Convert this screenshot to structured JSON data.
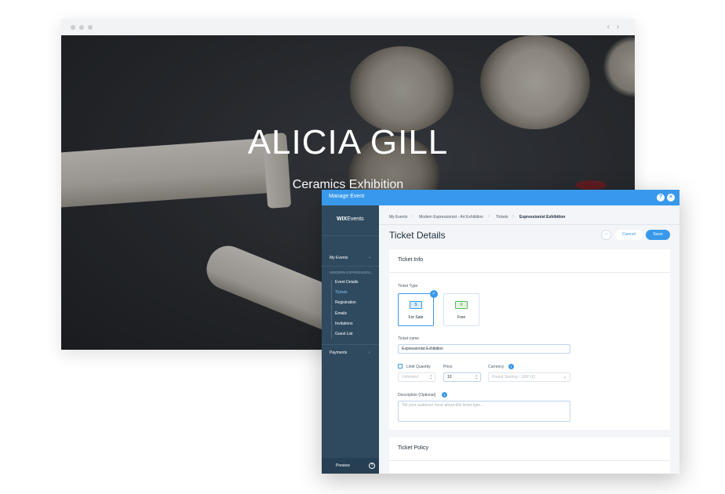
{
  "hero": {
    "title": "ALICIA GILL",
    "subtitle": "Ceramics Exhibition"
  },
  "dialog": {
    "title": "Manage Event",
    "help_icon": "?",
    "close_icon": "×"
  },
  "sidebar": {
    "logo_bold": "WIX",
    "logo_rest": "Events",
    "my_events": "My Events",
    "section": "MODERN EXPRESSIONI...",
    "items": [
      "Event Details",
      "Tickets",
      "Registration",
      "Emails",
      "Invitations",
      "Guest List"
    ],
    "payments": "Payments",
    "preview": "Preview"
  },
  "breadcrumb": {
    "items": [
      "My Events",
      "Modern Expressionist - Art Exhibition",
      "Tickets",
      "Expressionist Exhibition"
    ]
  },
  "page": {
    "title": "Ticket Details",
    "more_label": "···",
    "cancel_label": "Cancel",
    "save_label": "Save"
  },
  "ticket_info": {
    "title": "Ticket Info",
    "type_label": "Ticket Type",
    "types": [
      {
        "label": "For Sale",
        "icon": "$",
        "selected": true
      },
      {
        "label": "Free",
        "icon": "0",
        "selected": false
      }
    ],
    "name_label": "Ticket name",
    "name_value": "Expressionist Exhibition",
    "limit_label": "Limit Quantity",
    "limit_value": "Unlimited",
    "price_label": "Price",
    "price_value": "10",
    "currency_label": "Currency",
    "currency_value": "Pound Sterling - GBP (£)",
    "description_label": "Description (Optional)",
    "description_placeholder": "Tell your audience more about this ticket type..."
  },
  "ticket_policy": {
    "title": "Ticket Policy"
  },
  "colors": {
    "accent": "#3899ec",
    "sidebar": "#2f4a5f",
    "free_icon": "#5cb85c"
  }
}
